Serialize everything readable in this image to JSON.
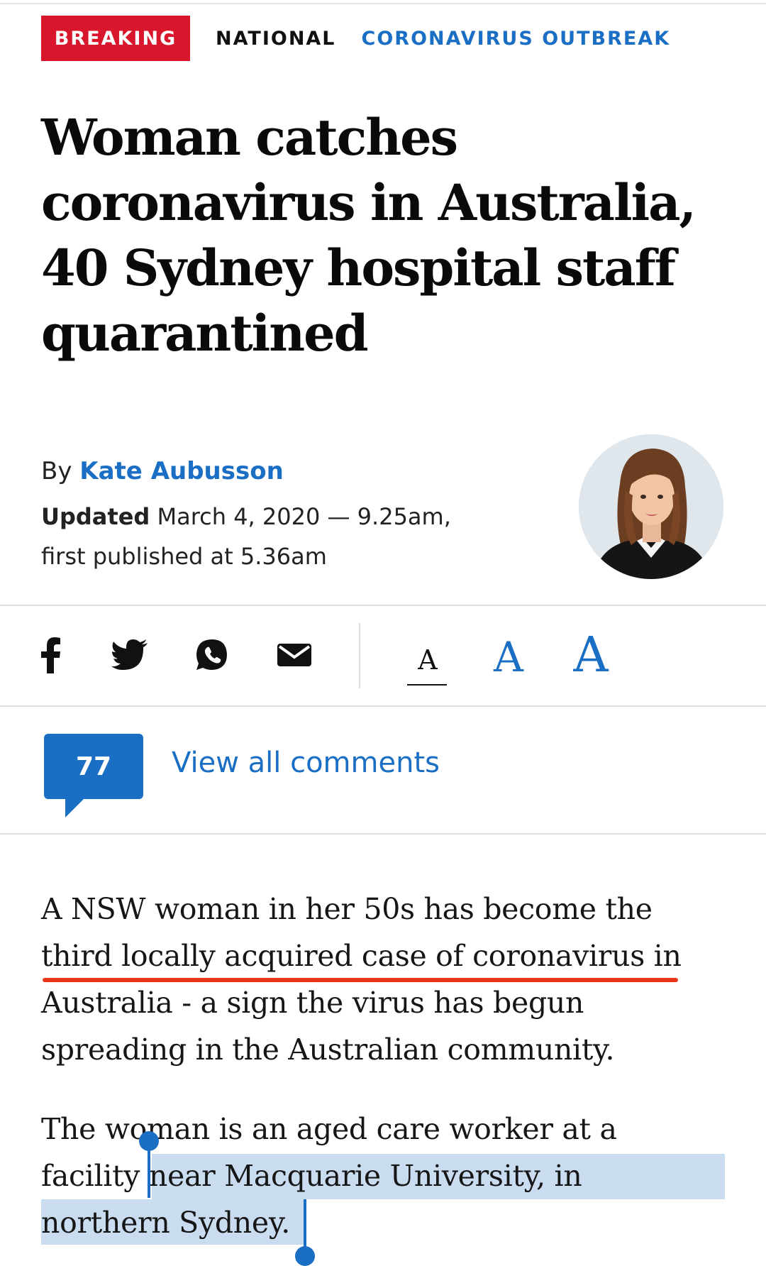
{
  "tags": {
    "breaking": "BREAKING",
    "national": "NATIONAL",
    "section": "CORONAVIRUS OUTBREAK"
  },
  "headline": "Woman catches coronavirus in Australia, 40 Sydney hospital staff quarantined",
  "byline": {
    "by": "By",
    "author": "Kate Aubusson",
    "updated_label": "Updated",
    "updated_text": "March 4, 2020 — 9.25am, first published at 5.36am"
  },
  "share": {
    "icons": [
      "facebook-icon",
      "twitter-icon",
      "whatsapp-icon",
      "email-icon"
    ],
    "font_sizes": [
      "A",
      "A",
      "A"
    ],
    "selected_font_size": "small"
  },
  "comments": {
    "count": "77",
    "link": "View all comments"
  },
  "article": {
    "p1_line1": "A NSW woman in her 50s has become the",
    "p1_line2": "third locally acquired case of coronavirus in",
    "p1_line3": "Australia - a sign the virus has begun",
    "p1_line4": "spreading in the Australian community.",
    "p2_line1": "The woman is an aged care worker at a",
    "p2_line2": "facility near Macquarie University, in",
    "p2_line3": "northern Sydney.",
    "selected_text": "near Macquarie University, in northern Sydney."
  },
  "colors": {
    "breaking_bg": "#d9172c",
    "accent_blue": "#1a6fc4",
    "underline_red": "#e8351c",
    "selection": "#c9dcf0"
  }
}
